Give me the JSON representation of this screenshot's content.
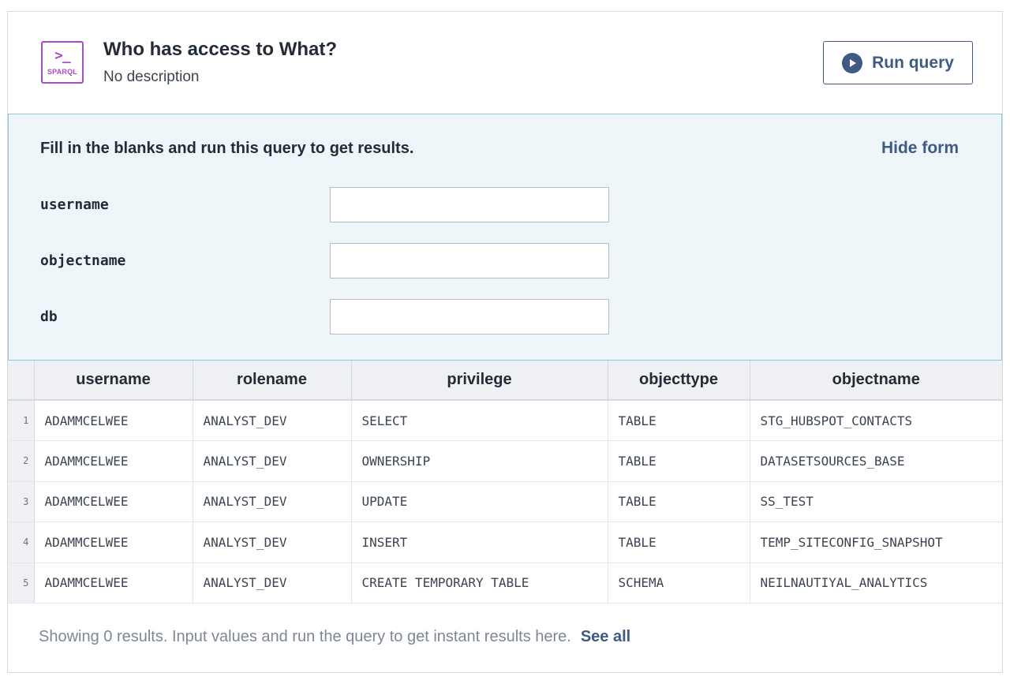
{
  "header": {
    "icon_prompt": ">_",
    "icon_tag": "SPARQL",
    "title": "Who has access to What?",
    "description": "No description",
    "run_label": "Run query"
  },
  "form": {
    "instructions": "Fill in the blanks and run this query to get results.",
    "hide_label": "Hide form",
    "fields": [
      {
        "label": "username",
        "value": ""
      },
      {
        "label": "objectname",
        "value": ""
      },
      {
        "label": "db",
        "value": ""
      }
    ]
  },
  "table": {
    "columns": [
      "username",
      "rolename",
      "privilege",
      "objecttype",
      "objectname"
    ],
    "rows": [
      {
        "index": "1",
        "cells": [
          "ADAMMCELWEE",
          "ANALYST_DEV",
          "SELECT",
          "TABLE",
          "STG_HUBSPOT_CONTACTS"
        ]
      },
      {
        "index": "2",
        "cells": [
          "ADAMMCELWEE",
          "ANALYST_DEV",
          "OWNERSHIP",
          "TABLE",
          "DATASETSOURCES_BASE"
        ]
      },
      {
        "index": "3",
        "cells": [
          "ADAMMCELWEE",
          "ANALYST_DEV",
          "UPDATE",
          "TABLE",
          "SS_TEST"
        ]
      },
      {
        "index": "4",
        "cells": [
          "ADAMMCELWEE",
          "ANALYST_DEV",
          "INSERT",
          "TABLE",
          "TEMP_SITECONFIG_SNAPSHOT"
        ]
      },
      {
        "index": "5",
        "cells": [
          "ADAMMCELWEE",
          "ANALYST_DEV",
          "CREATE TEMPORARY TABLE",
          "SCHEMA",
          "NEILNAUTIYAL_ANALYTICS"
        ]
      }
    ]
  },
  "footer": {
    "message": "Showing 0 results. Input values and run the query to get instant results here.",
    "see_all": "See all"
  },
  "colors": {
    "accent": "#3e5a85",
    "sparql": "#a64dc4",
    "form_bg": "#eef6f9",
    "form_border": "#8fc6d8"
  }
}
